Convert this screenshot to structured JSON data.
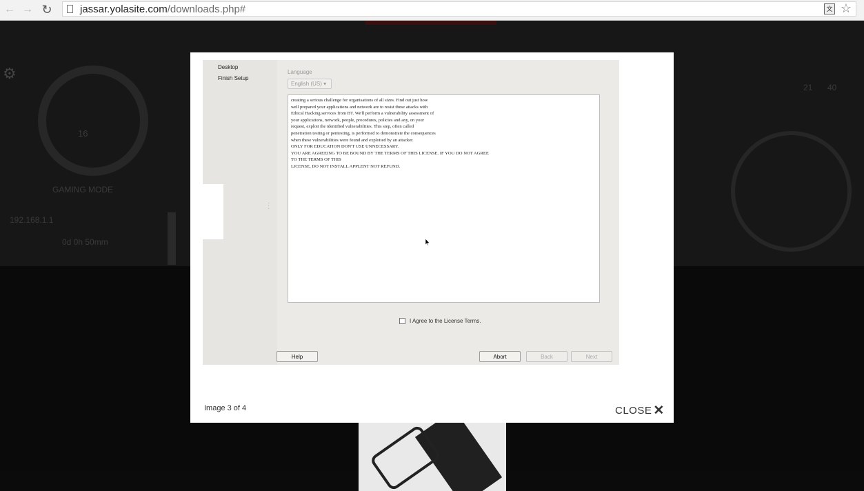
{
  "browser": {
    "url_host": "jassar.yolasite.com",
    "url_path": "/downloads.php#",
    "back_icon": "back-arrow-icon",
    "forward_icon": "forward-arrow-icon",
    "reload_icon": "reload-icon"
  },
  "background": {
    "labels": {
      "cpu_value": "16",
      "gaming_mode": "GAMING MODE",
      "ip": "192.168.1.1",
      "uptime": "0d 0h 50mm",
      "swap": "21",
      "ram": "40"
    }
  },
  "installer": {
    "sidebar": [
      "Desktop",
      "Finish Setup"
    ],
    "language_label": "Language",
    "language_value": "English (US)",
    "license_lines": [
      "creating a serious challenge for organisations of all sizes. Find out just how",
      "well prepared your applications and network are to resist these attacks with",
      "Ethical Hacking services from BT. We'll perform a vulnerability assessment of",
      "your applications, network, people, procedures, policies and any, on your",
      "request, exploit the identified vulnerabilities. This step, often called",
      "penetration testing or pentesting, is performed to demonstrate the consequences",
      "when these vulnerabilities were found and exploited by an attacker.",
      "ONLY FOR EDUCATION DON'T USE UNNECESSARY.",
      "YOU ARE AGREEING TO BE BOUND BY THE TERMS OF THIS LICENSE. IF YOU DO NOT AGREE",
      "TO THE TERMS OF THIS",
      "LICENSE, DO NOT INSTALL APPLENT NOT REFUND."
    ],
    "agree_label": "I Agree to the License Terms.",
    "buttons": {
      "help": "Help",
      "abort": "Abort",
      "back": "Back",
      "next": "Next"
    }
  },
  "lightbox": {
    "caption": "Image 3 of 4",
    "close_label": "CLOSE",
    "close_icon": "✕"
  }
}
